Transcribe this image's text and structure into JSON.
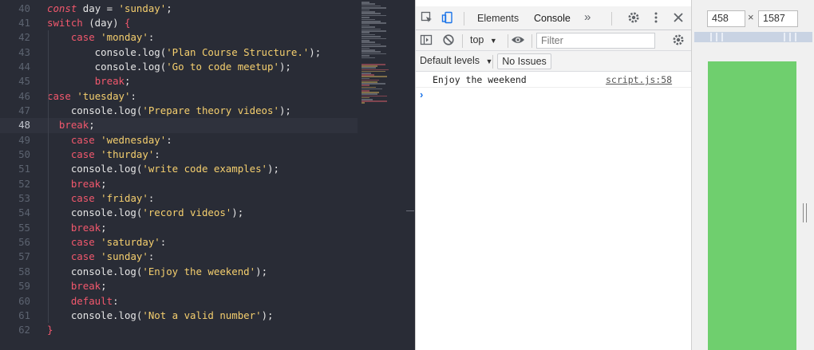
{
  "editor": {
    "active_line": "48",
    "lines": [
      {
        "n": "40",
        "parts": [
          [
            "kwi",
            "const"
          ],
          [
            "var",
            " day = "
          ],
          [
            "str",
            "'sunday'"
          ],
          [
            "var",
            ";"
          ]
        ]
      },
      {
        "n": "41",
        "parts": [
          [
            "kw",
            "switch"
          ],
          [
            "var",
            " (day) "
          ],
          [
            "kw",
            "{"
          ]
        ]
      },
      {
        "n": "42",
        "parts": [
          [
            "var",
            "    "
          ],
          [
            "kw",
            "case"
          ],
          [
            "var",
            " "
          ],
          [
            "str",
            "'monday'"
          ],
          [
            "var",
            ":"
          ]
        ]
      },
      {
        "n": "43",
        "parts": [
          [
            "var",
            "        console.log("
          ],
          [
            "str",
            "'Plan Course Structure.'"
          ],
          [
            "var",
            ");"
          ]
        ]
      },
      {
        "n": "44",
        "parts": [
          [
            "var",
            "        console.log("
          ],
          [
            "str",
            "'Go to code meetup'"
          ],
          [
            "var",
            ");"
          ]
        ]
      },
      {
        "n": "45",
        "parts": [
          [
            "var",
            "        "
          ],
          [
            "kw",
            "break"
          ],
          [
            "var",
            ";"
          ]
        ]
      },
      {
        "n": "46",
        "parts": [
          [
            "kw",
            "case"
          ],
          [
            "var",
            " "
          ],
          [
            "str",
            "'tuesday'"
          ],
          [
            "var",
            ":"
          ]
        ]
      },
      {
        "n": "47",
        "parts": [
          [
            "var",
            "    console.log("
          ],
          [
            "str",
            "'Prepare theory videos'"
          ],
          [
            "var",
            ");"
          ]
        ]
      },
      {
        "n": "48",
        "parts": [
          [
            "var",
            "  "
          ],
          [
            "kw",
            "break"
          ],
          [
            "var",
            ";"
          ]
        ]
      },
      {
        "n": "49",
        "parts": [
          [
            "var",
            "    "
          ],
          [
            "kw",
            "case"
          ],
          [
            "var",
            " "
          ],
          [
            "str",
            "'wednesday'"
          ],
          [
            "var",
            ":"
          ]
        ]
      },
      {
        "n": "50",
        "parts": [
          [
            "var",
            "    "
          ],
          [
            "kw",
            "case"
          ],
          [
            "var",
            " "
          ],
          [
            "str",
            "'thurday'"
          ],
          [
            "var",
            ":"
          ]
        ]
      },
      {
        "n": "51",
        "parts": [
          [
            "var",
            "    console.log("
          ],
          [
            "str",
            "'write code examples'"
          ],
          [
            "var",
            ");"
          ]
        ]
      },
      {
        "n": "52",
        "parts": [
          [
            "var",
            "    "
          ],
          [
            "kw",
            "break"
          ],
          [
            "var",
            ";"
          ]
        ]
      },
      {
        "n": "53",
        "parts": [
          [
            "var",
            "    "
          ],
          [
            "kw",
            "case"
          ],
          [
            "var",
            " "
          ],
          [
            "str",
            "'friday'"
          ],
          [
            "var",
            ":"
          ]
        ]
      },
      {
        "n": "54",
        "parts": [
          [
            "var",
            "    console.log("
          ],
          [
            "str",
            "'record videos'"
          ],
          [
            "var",
            ");"
          ]
        ]
      },
      {
        "n": "55",
        "parts": [
          [
            "var",
            "    "
          ],
          [
            "kw",
            "break"
          ],
          [
            "var",
            ";"
          ]
        ]
      },
      {
        "n": "56",
        "parts": [
          [
            "var",
            "    "
          ],
          [
            "kw",
            "case"
          ],
          [
            "var",
            " "
          ],
          [
            "str",
            "'saturday'"
          ],
          [
            "var",
            ":"
          ]
        ]
      },
      {
        "n": "57",
        "parts": [
          [
            "var",
            "    "
          ],
          [
            "kw",
            "case"
          ],
          [
            "var",
            " "
          ],
          [
            "str",
            "'sunday'"
          ],
          [
            "var",
            ":"
          ]
        ]
      },
      {
        "n": "58",
        "parts": [
          [
            "var",
            "    console.log("
          ],
          [
            "str",
            "'Enjoy the weekend'"
          ],
          [
            "var",
            ");"
          ]
        ]
      },
      {
        "n": "59",
        "parts": [
          [
            "var",
            "    "
          ],
          [
            "kw",
            "break"
          ],
          [
            "var",
            ";"
          ]
        ]
      },
      {
        "n": "60",
        "parts": [
          [
            "var",
            "    "
          ],
          [
            "kw",
            "default"
          ],
          [
            "var",
            ":"
          ]
        ]
      },
      {
        "n": "61",
        "parts": [
          [
            "var",
            "    console.log("
          ],
          [
            "str",
            "'Not a valid number'"
          ],
          [
            "var",
            ");"
          ]
        ]
      },
      {
        "n": "62",
        "parts": [
          [
            "kw",
            "}"
          ]
        ]
      }
    ]
  },
  "devtools": {
    "tabs": [
      "Elements",
      "Console"
    ],
    "selected_tab": "Console",
    "more_tabs_glyph": "»",
    "context": "top",
    "filter_placeholder": "Filter",
    "levels_label": "Default levels",
    "issues_label": "No Issues",
    "log": {
      "message": "Enjoy the weekend",
      "source": "script.js:58"
    },
    "prompt_glyph": "›"
  },
  "viewport": {
    "width": "458",
    "height": "1587",
    "times": "×",
    "fill_color": "#6fcf6e"
  },
  "colors": {
    "keyword": "#f2586d",
    "string": "#f5cf6e",
    "editor_bg": "#292c36",
    "accent": "#1a73e8"
  }
}
